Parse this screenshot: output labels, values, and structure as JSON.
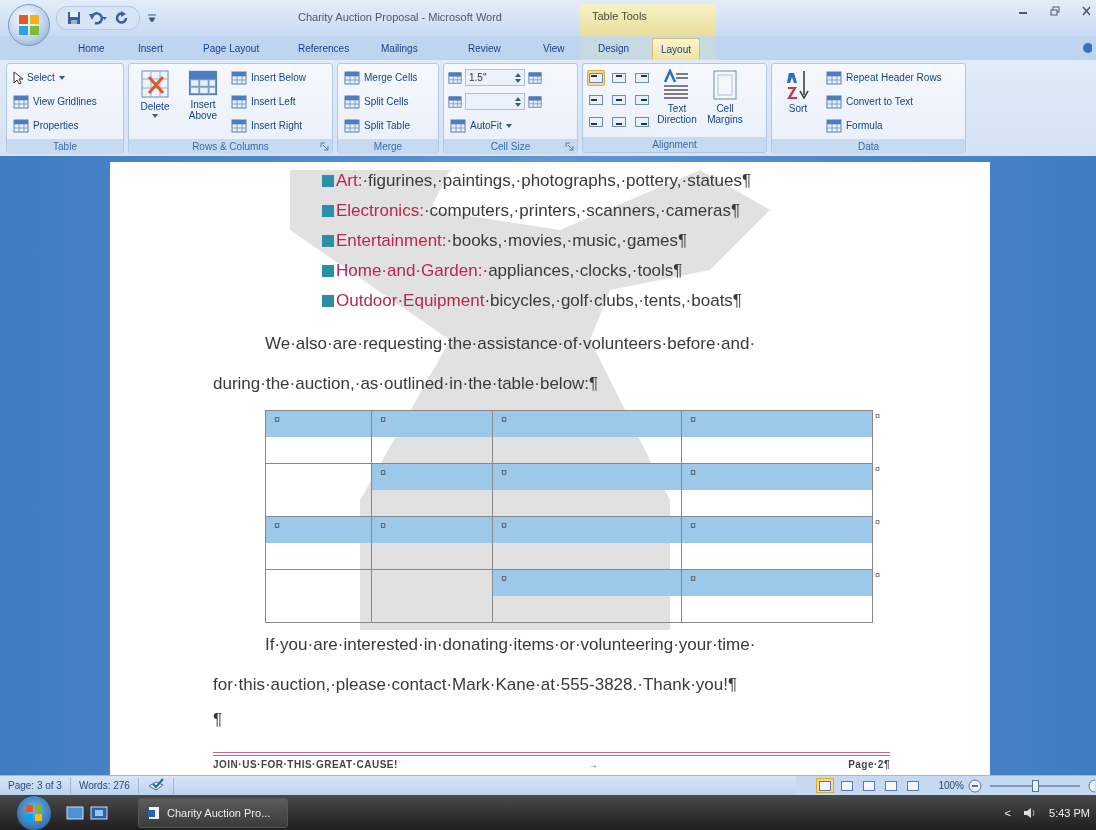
{
  "window": {
    "title": "Charity Auction Proposal - Microsoft Word",
    "context_label": "Table Tools"
  },
  "tabs": [
    {
      "label": "Home",
      "selected": false
    },
    {
      "label": "Insert",
      "selected": false
    },
    {
      "label": "Page Layout",
      "selected": false
    },
    {
      "label": "References",
      "selected": false
    },
    {
      "label": "Mailings",
      "selected": false
    },
    {
      "label": "Review",
      "selected": false
    },
    {
      "label": "View",
      "selected": false
    },
    {
      "label": "Design",
      "selected": false
    },
    {
      "label": "Layout",
      "selected": true
    }
  ],
  "ribbon": {
    "groups": [
      {
        "label": "Table",
        "launcher": false,
        "items": [
          {
            "kind": "small",
            "label": "Select",
            "dropdown": true
          },
          {
            "kind": "small",
            "label": "View Gridlines",
            "dropdown": false
          },
          {
            "kind": "small",
            "label": "Properties",
            "dropdown": false
          }
        ]
      },
      {
        "label": "Rows & Columns",
        "launcher": true,
        "items": [
          {
            "kind": "large",
            "label": "Delete",
            "dropdown": true
          },
          {
            "kind": "large",
            "label": "Insert Above",
            "dropdown": false
          },
          {
            "kind": "small",
            "label": "Insert Below",
            "dropdown": false
          },
          {
            "kind": "small",
            "label": "Insert Left",
            "dropdown": false
          },
          {
            "kind": "small",
            "label": "Insert Right",
            "dropdown": false
          }
        ]
      },
      {
        "label": "Merge",
        "launcher": false,
        "items": [
          {
            "kind": "small",
            "label": "Merge Cells",
            "dropdown": false
          },
          {
            "kind": "small",
            "label": "Split Cells",
            "dropdown": false
          },
          {
            "kind": "small",
            "label": "Split Table",
            "dropdown": false
          }
        ]
      },
      {
        "label": "Cell Size",
        "launcher": true,
        "items": [
          {
            "kind": "field",
            "value": "1.5\""
          },
          {
            "kind": "field"
          },
          {
            "kind": "small",
            "label": "AutoFit",
            "dropdown": true
          }
        ]
      },
      {
        "label": "Alignment",
        "launcher": false,
        "items": [
          {
            "kind": "align-grid",
            "cells": [
              {
                "selected": true
              },
              {
                "selected": false
              },
              {
                "selected": false
              },
              {
                "selected": false
              },
              {
                "selected": false
              },
              {
                "selected": false
              },
              {
                "selected": false
              },
              {
                "selected": false
              },
              {
                "selected": false
              }
            ]
          },
          {
            "kind": "large",
            "label": "Text Direction",
            "dropdown": false
          },
          {
            "kind": "large",
            "label": "Cell Margins",
            "dropdown": false
          }
        ]
      },
      {
        "label": "Data",
        "launcher": false,
        "items": [
          {
            "kind": "large",
            "label": "Sort",
            "dropdown": false
          },
          {
            "kind": "small",
            "label": "Repeat Header Rows",
            "dropdown": false
          },
          {
            "kind": "small",
            "label": "Convert to Text",
            "dropdown": false
          },
          {
            "kind": "small",
            "label": "Formula",
            "dropdown": false
          }
        ]
      }
    ]
  },
  "document": {
    "bullets": [
      {
        "category": "Art:",
        "details": "·figurines,·paintings,·photographs,·pottery,·statues¶"
      },
      {
        "category": "Electronics:",
        "details": "·computers,·printers,·scanners,·cameras¶"
      },
      {
        "category": "Entertainment:",
        "details": "·books,·movies,·music,·games¶"
      },
      {
        "category": "Home·and·Garden:",
        "details": "·appliances,·clocks,·tools¶"
      },
      {
        "category": "Outdoor·Equipment",
        "details": "·bicycles,·golf·clubs,·tents,·boats¶"
      }
    ],
    "intro": "We·also·are·requesting·the·assistance·of·volunteers·before·and· during·the·auction,·as·outlined·in·the·table·below:¶",
    "table": {
      "rows": [
        {
          "cells": [
            {
              "mark": "¤",
              "selected": true
            },
            {
              "mark": "¤",
              "selected": true
            },
            {
              "mark": "¤",
              "selected": true
            },
            {
              "mark": "¤",
              "selected": true
            }
          ],
          "end_mark": "¤"
        },
        {
          "cells": [
            {
              "selected": false
            },
            {
              "mark": "¤",
              "selected": true
            },
            {
              "mark": "¤",
              "selected": true
            },
            {
              "mark": "¤",
              "selected": true
            }
          ],
          "end_mark": "¤"
        },
        {
          "cells": [
            {
              "mark": "¤",
              "selected": true
            },
            {
              "mark": "¤",
              "selected": true
            },
            {
              "mark": "¤",
              "selected": true
            },
            {
              "mark": "¤",
              "selected": true
            }
          ],
          "end_mark": "¤"
        },
        {
          "cells": [
            {
              "selected": false
            },
            {
              "selected": false
            },
            {
              "mark": "¤",
              "selected": true
            },
            {
              "mark": "¤",
              "selected": true
            }
          ],
          "end_mark": "¤"
        }
      ]
    },
    "closing": "If·you·are·interested·in·donating·items·or·volunteering·your·time· for·this·auction,·please·contact·Mark·Kane·at·555-3828.·Thank·you!¶",
    "empty_paragraph": "¶",
    "footer": {
      "left": "JOIN·US·FOR·THIS·GREAT·CAUSE!",
      "tab": "→",
      "right": "Page·2¶"
    }
  },
  "status_bar": {
    "page": "Page: 3 of 3",
    "words": "Words: 276",
    "views": [
      {
        "selected": true
      },
      {
        "selected": false
      },
      {
        "selected": false
      },
      {
        "selected": false
      },
      {
        "selected": false
      }
    ],
    "zoom": "100%",
    "zoom_slider": {
      "level": 0.5
    }
  },
  "taskbar": {
    "tasks": [
      {
        "label": "Charity Auction Pro...",
        "selected": true
      }
    ],
    "tray_toggle": "<",
    "clock": "5:43 PM"
  }
}
